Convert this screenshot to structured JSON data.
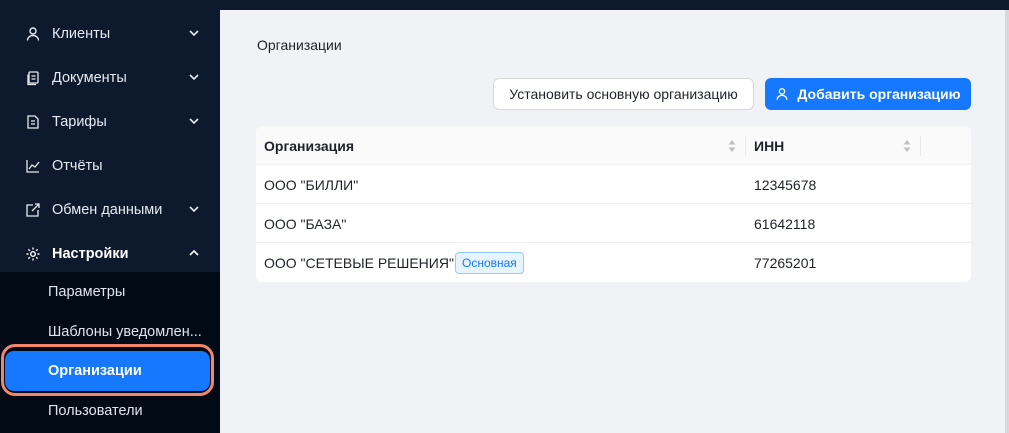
{
  "sidebar": {
    "items": [
      {
        "label": "Клиенты",
        "icon": "user-icon"
      },
      {
        "label": "Документы",
        "icon": "documents-icon"
      },
      {
        "label": "Тарифы",
        "icon": "tariff-icon"
      },
      {
        "label": "Отчёты",
        "icon": "chart-icon"
      },
      {
        "label": "Обмен данными",
        "icon": "data-exchange-icon"
      },
      {
        "label": "Настройки",
        "icon": "gear-icon"
      }
    ],
    "settings_submenu": [
      {
        "label": "Параметры"
      },
      {
        "label": "Шаблоны уведомлен..."
      },
      {
        "label": "Организации",
        "active": true
      },
      {
        "label": "Пользователи"
      }
    ]
  },
  "main": {
    "breadcrumb": "Организации",
    "buttons": {
      "set_main": "Установить основную организацию",
      "add": "Добавить организацию"
    },
    "table": {
      "columns": [
        "Организация",
        "ИНН"
      ],
      "rows": [
        {
          "organization": "ООО \"БИЛЛИ\"",
          "inn": "12345678"
        },
        {
          "organization": "ООО \"БАЗА\"",
          "inn": "61642118"
        },
        {
          "organization": "ООО \"СЕТЕВЫЕ РЕШЕНИЯ\"",
          "inn": "77265201",
          "tag": "Основная"
        }
      ]
    }
  },
  "colors": {
    "sidebar_bg": "#0d1a2e",
    "accent": "#1677ff",
    "highlight_ring": "#f0866a"
  }
}
